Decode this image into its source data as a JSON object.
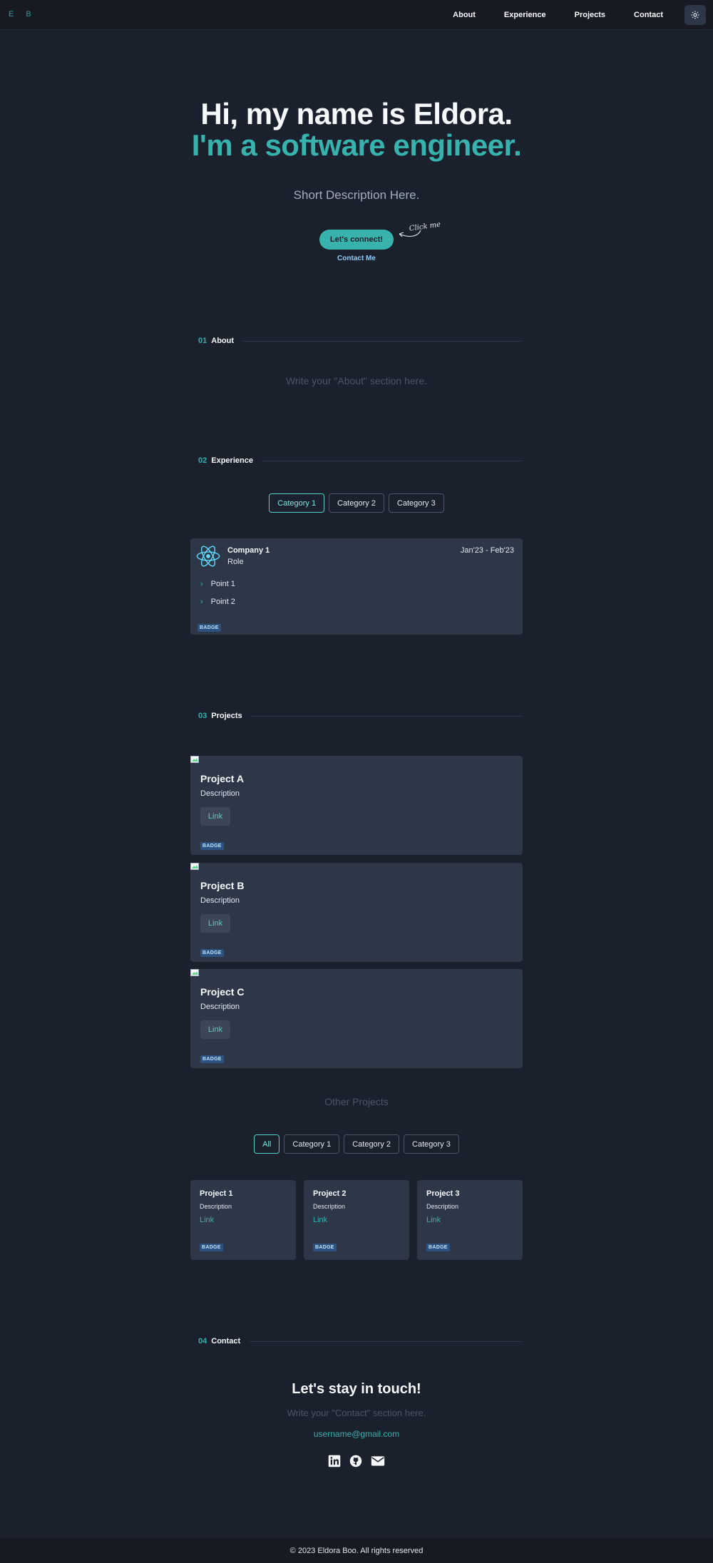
{
  "nav": {
    "logo": "E B",
    "items": [
      "About",
      "Experience",
      "Projects",
      "Contact"
    ],
    "theme_icon": "sun-icon"
  },
  "hero": {
    "line1": "Hi, my name is Eldora.",
    "line2": "I'm a software engineer.",
    "description": "Short Description Here.",
    "cta": "Let's connect!",
    "click_me": "Click me!",
    "contact_link": "Contact Me"
  },
  "about": {
    "number": "01",
    "title": "About",
    "text": "Write your \"About\" section here."
  },
  "experience": {
    "number": "02",
    "title": "Experience",
    "tabs": [
      "Category 1",
      "Category 2",
      "Category 3"
    ],
    "active_tab": "Category 1",
    "card": {
      "logo_icon": "react-icon",
      "company": "Company 1",
      "role": "Role",
      "dates": "Jan'23 - Feb'23",
      "points": [
        "Point 1",
        "Point 2"
      ],
      "badge": "BADGE"
    }
  },
  "projects": {
    "number": "03",
    "title": "Projects",
    "items": [
      {
        "title": "Project A",
        "description": "Description",
        "link": "Link",
        "badge": "BADGE"
      },
      {
        "title": "Project B",
        "description": "Description",
        "link": "Link",
        "badge": "BADGE"
      },
      {
        "title": "Project C",
        "description": "Description",
        "link": "Link",
        "badge": "BADGE"
      }
    ],
    "other_heading": "Other Projects",
    "other_tabs": [
      "All",
      "Category 1",
      "Category 2",
      "Category 3"
    ],
    "other_active_tab": "All",
    "other_items": [
      {
        "title": "Project 1",
        "description": "Description",
        "link": "Link",
        "badge": "BADGE"
      },
      {
        "title": "Project 2",
        "description": "Description",
        "link": "Link",
        "badge": "BADGE"
      },
      {
        "title": "Project 3",
        "description": "Description",
        "link": "Link",
        "badge": "BADGE"
      }
    ]
  },
  "contact": {
    "number": "04",
    "title": "Contact",
    "heading": "Let's stay in touch!",
    "text": "Write your \"Contact\" section here.",
    "email": "username@gmail.com",
    "social_icons": [
      "linkedin-icon",
      "github-icon",
      "email-icon"
    ]
  },
  "footer": {
    "text": "© 2023 Eldora Boo. All rights reserved"
  },
  "colors": {
    "background": "#1a202c",
    "card": "#2d3748",
    "accent": "#38b2ac",
    "link_blue": "#90cdf4"
  }
}
